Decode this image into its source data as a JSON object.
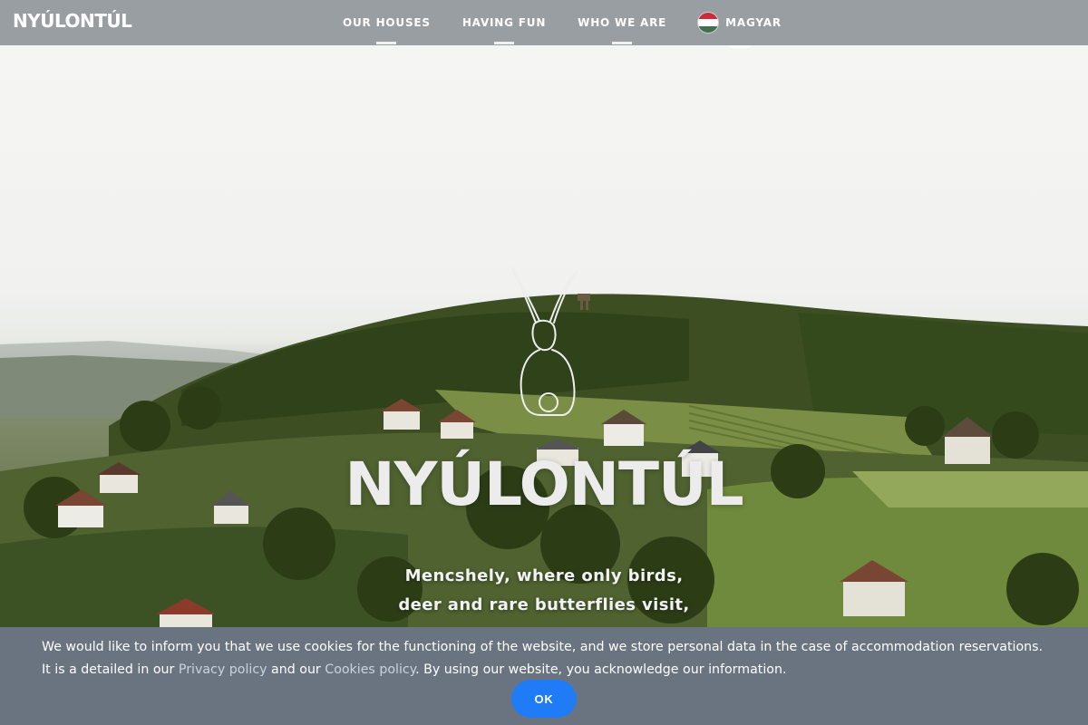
{
  "brand": {
    "name": "NYÚLONTÚL"
  },
  "nav": {
    "items": [
      {
        "label": "OUR HOUSES"
      },
      {
        "label": "HAVING FUN"
      },
      {
        "label": "WHO WE ARE"
      }
    ],
    "language": {
      "label": "MAGYAR",
      "flag_icon": "hungary-flag-icon",
      "flag_colors": [
        "#cd2a3e",
        "#ffffff",
        "#436f4d"
      ]
    }
  },
  "hero": {
    "title": "NYÚLONTÚL",
    "tagline_line1": "Mencshely, where only birds,",
    "tagline_line2": "deer and rare butterflies visit,",
    "logo_icon": "rabbit-outline-icon"
  },
  "cookie_banner": {
    "text_before": "We would like to inform you that we use cookies for the functioning of the website, and we store personal data in the case of accommodation reservations. It is a detailed in our ",
    "privacy_link": "Privacy policy",
    "text_middle": " and our ",
    "cookies_link": "Cookies policy",
    "text_after": ". By using our website, you acknowledge our information.",
    "ok_label": "OK"
  },
  "colors": {
    "topbar": "#999ea3",
    "cookie_bg": "#6a7480",
    "ok_button": "#1f7cf6",
    "link": "#c9d3de"
  }
}
